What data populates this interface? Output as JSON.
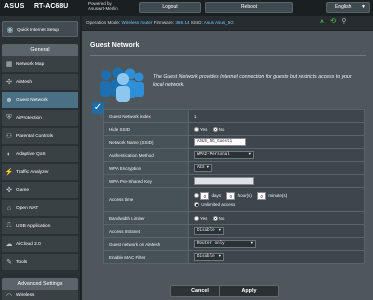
{
  "header": {
    "brand": "ASUS",
    "model": "RT-AC68U",
    "user_line1": "Powered by",
    "user_line2": "Asuswrt-Merlin",
    "logout": "Logout",
    "reboot": "Reboot",
    "language": "English"
  },
  "status": {
    "mode_label": "Operation Mode:",
    "mode_value": "Wireless router",
    "fw_label": "Firmware:",
    "fw_value": "386.14",
    "ssid_label": "SSID:",
    "ssid_values": "Asus  Asus_5G"
  },
  "sidebar": {
    "qis": "Quick Internet Setup",
    "general": "General",
    "items": [
      {
        "label": "Network Map",
        "icon": "network-map-icon"
      },
      {
        "label": "AiMesh",
        "icon": "aimesh-icon"
      },
      {
        "label": "Guest Network",
        "icon": "guest-network-icon"
      },
      {
        "label": "AiProtection",
        "icon": "aiprotection-icon"
      },
      {
        "label": "Parental Controls",
        "icon": "parental-controls-icon"
      },
      {
        "label": "Adaptive QoS",
        "icon": "adaptive-qos-icon"
      },
      {
        "label": "Traffic Analyzer",
        "icon": "traffic-analyzer-icon"
      },
      {
        "label": "Game",
        "icon": "game-icon"
      },
      {
        "label": "Open NAT",
        "icon": "open-nat-icon"
      },
      {
        "label": "USB Application",
        "icon": "usb-icon"
      },
      {
        "label": "AiCloud 2.0",
        "icon": "aicloud-icon"
      },
      {
        "label": "Tools",
        "icon": "tools-icon"
      }
    ],
    "advanced": "Advanced Settings",
    "wireless": "Wireless"
  },
  "main": {
    "title": "Guest Network",
    "description": "The Guest Network provides Internet connection for guests but restricts access to your local network.",
    "rows": {
      "index_label": "Guest Network index",
      "index_value": "1",
      "hide_ssid_label": "Hide SSID",
      "yes": "Yes",
      "no": "No",
      "ssid_label": "Network Name (SSID)",
      "ssid_value": "ASUS_5G_Guest1",
      "auth_label": "Authentication Method",
      "auth_value": "WPA2-Personal",
      "enc_label": "WPA Encryption",
      "enc_value": "AES",
      "psk_label": "WPA Pre-Shared Key",
      "access_time_label": "Access time",
      "days_value": "0",
      "days_label": "days",
      "hours_value": "0",
      "hours_label": "hour(s)",
      "minutes_value": "0",
      "minutes_label": "minute(s)",
      "unlimited_label": "Unlimited access",
      "bw_label": "Bandwidth Limiter",
      "intranet_label": "Access Intranet",
      "intranet_value": "Disable",
      "aimesh_label": "Guest network on AiMesh",
      "aimesh_value": "Router only",
      "mac_label": "Enable MAC Filter",
      "mac_value": "Disable"
    },
    "cancel": "Cancel",
    "apply": "Apply"
  }
}
